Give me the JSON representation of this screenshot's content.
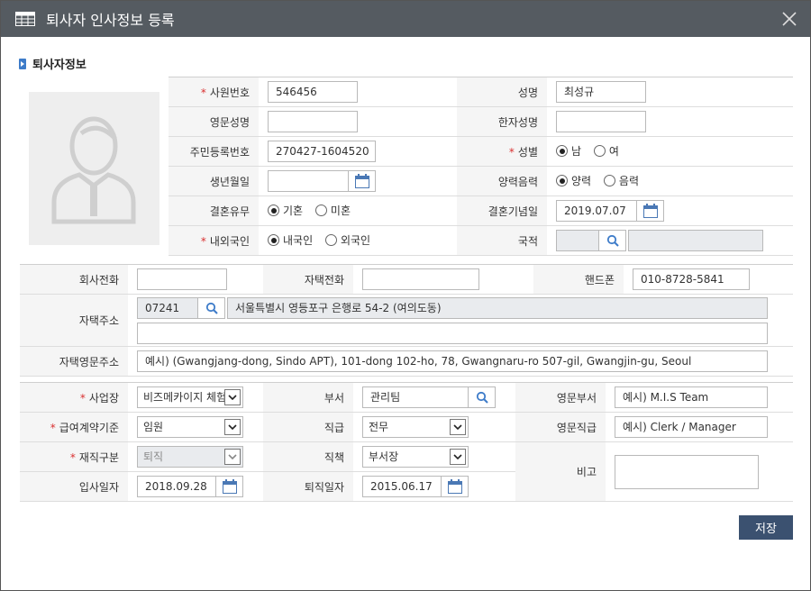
{
  "dialog": {
    "title": "퇴사자 인사정보 등록",
    "section_title": "퇴사자정보"
  },
  "personal": {
    "emp_no_label": "사원번호",
    "emp_no": "546456",
    "name_label": "성명",
    "name": "최성규",
    "eng_name_label": "영문성명",
    "eng_name": "",
    "hanja_name_label": "한자성명",
    "hanja_name": "",
    "rrn_label": "주민등록번호",
    "rrn": "270427-1604520",
    "gender_label": "성별",
    "gender_male": "남",
    "gender_female": "여",
    "birth_label": "생년월일",
    "birth": "",
    "calendar_type_label": "양력음력",
    "solar": "양력",
    "lunar": "음력",
    "marital_label": "결혼유무",
    "married": "기혼",
    "single": "미혼",
    "anniversary_label": "결혼기념일",
    "anniversary": "2019.07.07",
    "nationality_type_label": "내외국인",
    "domestic": "내국인",
    "foreign": "외국인",
    "country_label": "국적",
    "country_code": "",
    "country_name": ""
  },
  "contact": {
    "office_phone_label": "회사전화",
    "office_phone": "",
    "home_phone_label": "자택전화",
    "home_phone": "",
    "mobile_label": "핸드폰",
    "mobile": "010-8728-5841",
    "address_label": "자택주소",
    "zipcode": "07241",
    "address1": "서울특별시 영등포구 은행로 54-2 (여의도동)",
    "address2": "",
    "eng_address_label": "자택영문주소",
    "eng_address": "예시) (Gwangjang-dong, Sindo APT), 101-dong 102-ho, 78, Gwangnaru-ro 507-gil, Gwangjin-gu, Seoul"
  },
  "job": {
    "workplace_label": "사업장",
    "workplace": "비즈메카이지 체험",
    "dept_label": "부서",
    "dept": "관리팀",
    "eng_dept_label": "영문부서",
    "eng_dept": "예시) M.I.S Team",
    "pay_basis_label": "급여계약기준",
    "pay_basis": "임원",
    "grade_label": "직급",
    "grade": "전무",
    "eng_grade_label": "영문직급",
    "eng_grade": "예시) Clerk / Manager",
    "status_label": "재직구분",
    "status": "퇴직",
    "position_label": "직책",
    "position": "부서장",
    "note_label": "비고",
    "note": "",
    "join_label": "입사일자",
    "join_date": "2018.09.28",
    "leave_label": "퇴직일자",
    "leave_date": "2015.06.17"
  },
  "actions": {
    "save": "저장"
  },
  "colors": {
    "titlebar": "#555b61",
    "save_button": "#3b5170",
    "required": "#d93030",
    "accent": "#3e7cc9"
  }
}
